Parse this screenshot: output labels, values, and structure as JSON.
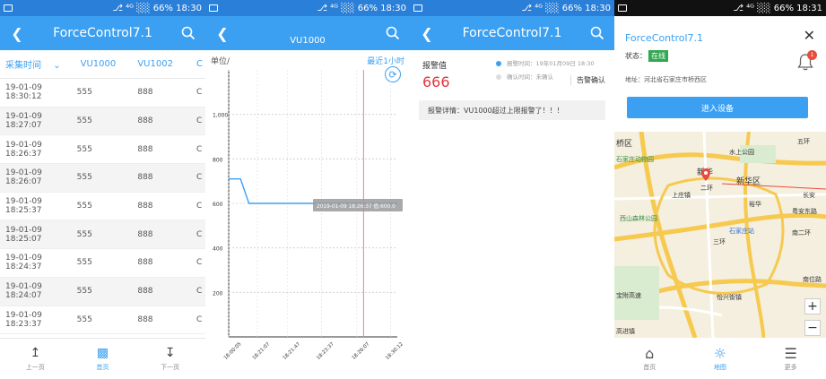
{
  "statusbar": {
    "signal_text": "⎇ ⁴ᴳ ░░ 66%",
    "time_p1": "18:30",
    "time_p2": "18:30",
    "time_p3": "18:30",
    "time_p4": "18:31"
  },
  "p1": {
    "title": "ForceControl7.1",
    "columns": [
      "采集时间",
      "VU1000",
      "VU1002",
      "C"
    ],
    "rows": [
      {
        "time": "19-01-09 18:30:12",
        "v1": "555",
        "v2": "888",
        "v3": "C"
      },
      {
        "time": "19-01-09 18:27:07",
        "v1": "555",
        "v2": "888",
        "v3": "C"
      },
      {
        "time": "19-01-09 18:26:37",
        "v1": "555",
        "v2": "888",
        "v3": "C"
      },
      {
        "time": "19-01-09 18:26:07",
        "v1": "555",
        "v2": "888",
        "v3": "C"
      },
      {
        "time": "19-01-09 18:25:37",
        "v1": "555",
        "v2": "888",
        "v3": "C"
      },
      {
        "time": "19-01-09 18:25:07",
        "v1": "555",
        "v2": "888",
        "v3": "C"
      },
      {
        "time": "19-01-09 18:24:37",
        "v1": "555",
        "v2": "888",
        "v3": "C"
      },
      {
        "time": "19-01-09 18:24:07",
        "v1": "555",
        "v2": "888",
        "v3": "C"
      },
      {
        "time": "19-01-09 18:23:37",
        "v1": "555",
        "v2": "888",
        "v3": "C"
      }
    ],
    "footer": {
      "prev": "上一页",
      "current": "首页",
      "next": "下一页"
    }
  },
  "p2": {
    "title": "VU1000",
    "unit_label": "单位/",
    "range_label": "最近1小时",
    "tooltip": "2019-01-09 18:26:37 值:600.0"
  },
  "chart_data": {
    "type": "line",
    "title": "VU1000",
    "ylabel": "单位/",
    "ylim": [
      0,
      1200
    ],
    "yticks": [
      200,
      400,
      600,
      800,
      "1,000"
    ],
    "xticks": [
      "18:00:05",
      "18:21:07",
      "18:21:47",
      "18:23:37",
      "18:26:07",
      "18:30:12"
    ],
    "x_positions": [
      0,
      0.17,
      0.35,
      0.55,
      0.76,
      0.96
    ],
    "series": [
      {
        "name": "VU1000",
        "points": [
          [
            0,
            710
          ],
          [
            0.07,
            710
          ],
          [
            0.12,
            600
          ],
          [
            1.0,
            600
          ]
        ]
      }
    ],
    "marker_x": 0.8,
    "colors": {
      "line": "#3ba0f2",
      "marker": "#e8857f"
    }
  },
  "p3": {
    "title": "ForceControl7.1",
    "alarm_label": "报警值",
    "alarm_value": "666",
    "alarm_time": "报警时间：19年01月09日 18:30",
    "confirm_time": "确认时间：未确认",
    "confirm_btn": "告警确认",
    "detail": "报警详情：VU1000超过上限报警了！！！"
  },
  "p4": {
    "title": "ForceControl7.1",
    "status_label": "状态：",
    "status_value": "在线",
    "bell_count": "1",
    "address": "地址：河北省石家庄市桥西区",
    "enter_btn": "进入设备",
    "map_labels": {
      "a": "桥区",
      "b": "石家庄动物园",
      "c": "水上公园",
      "d": "新华区",
      "e": "新华",
      "f": "上庄镇",
      "g": "长安",
      "h": "西山森林公园",
      "i": "粤安东路",
      "j": "石家庄站",
      "k": "裕华",
      "l": "五环",
      "m": "二环",
      "n": "三环",
      "o": "南二环",
      "p": "宝附高速",
      "q": "怡兴街镇",
      "r": "高进镇",
      "s": "南位路"
    },
    "tabs": [
      {
        "label": "首页",
        "icon": "home-icon"
      },
      {
        "label": "地图",
        "icon": "map-icon"
      },
      {
        "label": "更多",
        "icon": "menu-icon"
      }
    ]
  }
}
